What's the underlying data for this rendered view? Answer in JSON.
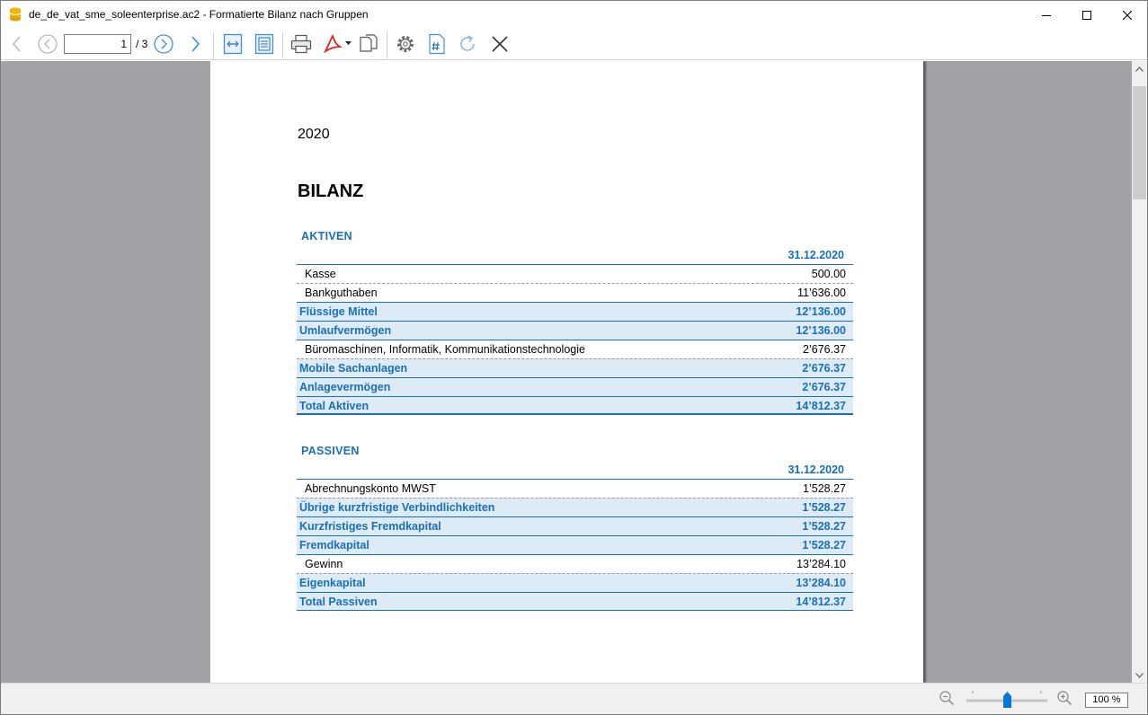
{
  "window": {
    "title": "de_de_vat_sme_soleenterprise.ac2 - Formatierte Bilanz nach Gruppen"
  },
  "toolbar": {
    "current_page": "1",
    "page_total": "/ 3",
    "icons": [
      "back-arrow-icon",
      "previous-page-icon",
      "next-page-icon",
      "forward-arrow-icon",
      "fit-width-icon",
      "fit-page-icon",
      "print-icon",
      "pdf-icon",
      "copy-icon",
      "settings-icon",
      "page-number-icon",
      "refresh-icon",
      "close-icon"
    ]
  },
  "report": {
    "year": "2020",
    "title": "BILANZ",
    "assets": {
      "section_title": "AKTIVEN",
      "column_header": "31.12.2020",
      "rows": [
        {
          "label": "Kasse",
          "value": "500.00",
          "type": "detail"
        },
        {
          "label": "Bankguthaben",
          "value": "11’636.00",
          "type": "detail"
        },
        {
          "label": "Flüssige Mittel",
          "value": "12’136.00",
          "type": "total"
        },
        {
          "label": "Umlaufvermögen",
          "value": "12’136.00",
          "type": "total"
        },
        {
          "label": "Büromaschinen, Informatik, Kommunikationstechnologie",
          "value": "2’676.37",
          "type": "detail"
        },
        {
          "label": "Mobile Sachanlagen",
          "value": "2’676.37",
          "type": "total"
        },
        {
          "label": "Anlagevermögen",
          "value": "2’676.37",
          "type": "total"
        },
        {
          "label": "Total Aktiven",
          "value": "14’812.37",
          "type": "total"
        }
      ]
    },
    "liabilities": {
      "section_title": "PASSIVEN",
      "column_header": "31.12.2020",
      "rows": [
        {
          "label": "Abrechnungskonto MWST",
          "value": "1’528.27",
          "type": "detail"
        },
        {
          "label": "Übrige kurzfristige Verbindlichkeiten",
          "value": "1’528.27",
          "type": "total"
        },
        {
          "label": "Kurzfristiges Fremdkapital",
          "value": "1’528.27",
          "type": "total"
        },
        {
          "label": "Fremdkapital",
          "value": "1’528.27",
          "type": "total"
        },
        {
          "label": "Gewinn",
          "value": "13’284.10",
          "type": "detail"
        },
        {
          "label": "Eigenkapital",
          "value": "13’284.10",
          "type": "total"
        },
        {
          "label": "Total Passiven",
          "value": "14’812.37",
          "type": "total"
        }
      ]
    }
  },
  "status": {
    "zoom": "100 %"
  },
  "colors": {
    "accent": "#1a6fb8",
    "total_row_bg": "#dcebf5",
    "viewport_bg": "#a3a2a7"
  }
}
